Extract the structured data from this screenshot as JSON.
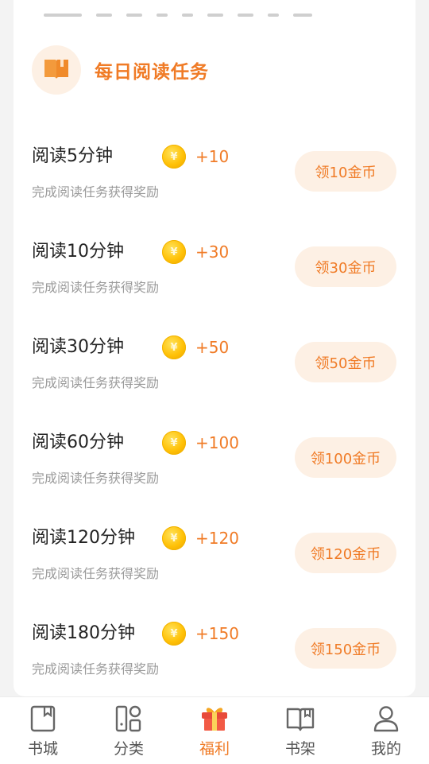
{
  "colors": {
    "accent": "#f07b26",
    "badge_bg": "#fdf0e4",
    "coin": "#ffc107"
  },
  "section": {
    "title": "每日阅读任务",
    "icon": "book-icon"
  },
  "coin_symbol": "¥",
  "tasks": [
    {
      "title": "阅读5分钟",
      "reward": "+10",
      "desc": "完成阅读任务获得奖励",
      "button": "领10金币"
    },
    {
      "title": "阅读10分钟",
      "reward": "+30",
      "desc": "完成阅读任务获得奖励",
      "button": "领30金币"
    },
    {
      "title": "阅读30分钟",
      "reward": "+50",
      "desc": "完成阅读任务获得奖励",
      "button": "领50金币"
    },
    {
      "title": "阅读60分钟",
      "reward": "+100",
      "desc": "完成阅读任务获得奖励",
      "button": "领100金币"
    },
    {
      "title": "阅读120分钟",
      "reward": "+120",
      "desc": "完成阅读任务获得奖励",
      "button": "领120金币"
    },
    {
      "title": "阅读180分钟",
      "reward": "+150",
      "desc": "完成阅读任务获得奖励",
      "button": "领150金币"
    }
  ],
  "tabbar": {
    "items": [
      {
        "label": "书城",
        "icon": "bookstore-icon"
      },
      {
        "label": "分类",
        "icon": "category-icon"
      },
      {
        "label": "福利",
        "icon": "gift-icon",
        "active": true
      },
      {
        "label": "书架",
        "icon": "bookshelf-icon"
      },
      {
        "label": "我的",
        "icon": "profile-icon"
      }
    ]
  }
}
